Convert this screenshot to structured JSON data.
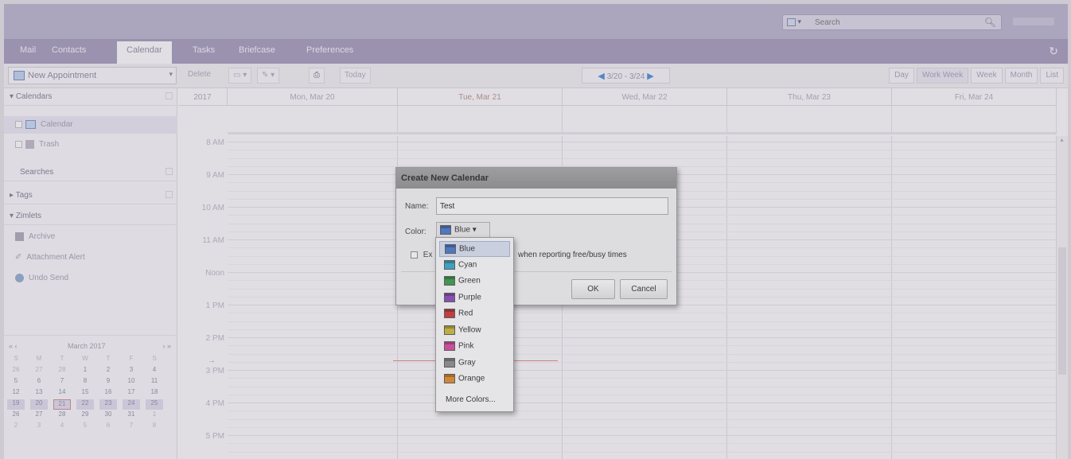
{
  "header": {
    "search_placeholder": "Search",
    "search_icon": "magnifier-icon"
  },
  "tabs": [
    {
      "label": "Mail"
    },
    {
      "label": "Contacts"
    },
    {
      "label": "Calendar"
    },
    {
      "label": "Tasks"
    },
    {
      "label": "Briefcase"
    },
    {
      "label": "Preferences"
    }
  ],
  "toolbar": {
    "new_appointment": "New Appointment",
    "delete": "Delete",
    "today": "Today",
    "date_range": "3/20 - 3/24",
    "views": [
      "Day",
      "Work Week",
      "Week",
      "Month",
      "List"
    ]
  },
  "sidebar": {
    "calendars_header": "Calendars",
    "calendar_item": "Calendar",
    "trash_item": "Trash",
    "searches_header": "Searches",
    "tags_header": "Tags",
    "zimlets_header": "Zimlets",
    "zimlets": [
      "Archive",
      "Attachment Alert",
      "Undo Send"
    ],
    "mini_calendar": {
      "month": "March 2017",
      "weekday_headers": [
        "S",
        "M",
        "T",
        "W",
        "T",
        "F",
        "S"
      ],
      "weeks": [
        [
          "26",
          "27",
          "28",
          "1",
          "2",
          "3",
          "4"
        ],
        [
          "5",
          "6",
          "7",
          "8",
          "9",
          "10",
          "11"
        ],
        [
          "12",
          "13",
          "14",
          "15",
          "16",
          "17",
          "18"
        ],
        [
          "19",
          "20",
          "21",
          "22",
          "23",
          "24",
          "25"
        ],
        [
          "26",
          "27",
          "28",
          "29",
          "30",
          "31",
          "1"
        ],
        [
          "2",
          "3",
          "4",
          "5",
          "6",
          "7",
          "8"
        ]
      ]
    }
  },
  "calendar": {
    "year": "2017",
    "days": [
      "Mon, Mar 20",
      "Tue, Mar 21",
      "Wed, Mar 22",
      "Thu, Mar 23",
      "Fri, Mar 24"
    ],
    "times": [
      "8 AM",
      "9 AM",
      "10 AM",
      "11 AM",
      "Noon",
      "1 PM",
      "2 PM",
      "3 PM",
      "4 PM",
      "5 PM"
    ]
  },
  "dialog": {
    "title": "Create New Calendar",
    "name_label": "Name:",
    "name_value": "Test",
    "color_label": "Color:",
    "color_selected": "Blue",
    "exclude_prefix": "Ex",
    "exclude_suffix": "when reporting free/busy times",
    "ok": "OK",
    "cancel": "Cancel"
  },
  "color_menu": {
    "items": [
      {
        "label": "Blue",
        "color": "#4a78c8"
      },
      {
        "label": "Cyan",
        "color": "#3aa8c4"
      },
      {
        "label": "Green",
        "color": "#3a9a4a"
      },
      {
        "label": "Purple",
        "color": "#8a4ab8"
      },
      {
        "label": "Red",
        "color": "#c83a3a"
      },
      {
        "label": "Yellow",
        "color": "#c8b83a"
      },
      {
        "label": "Pink",
        "color": "#d44aa0"
      },
      {
        "label": "Gray",
        "color": "#8a8a8a"
      },
      {
        "label": "Orange",
        "color": "#e08a2a"
      }
    ],
    "more": "More Colors..."
  }
}
